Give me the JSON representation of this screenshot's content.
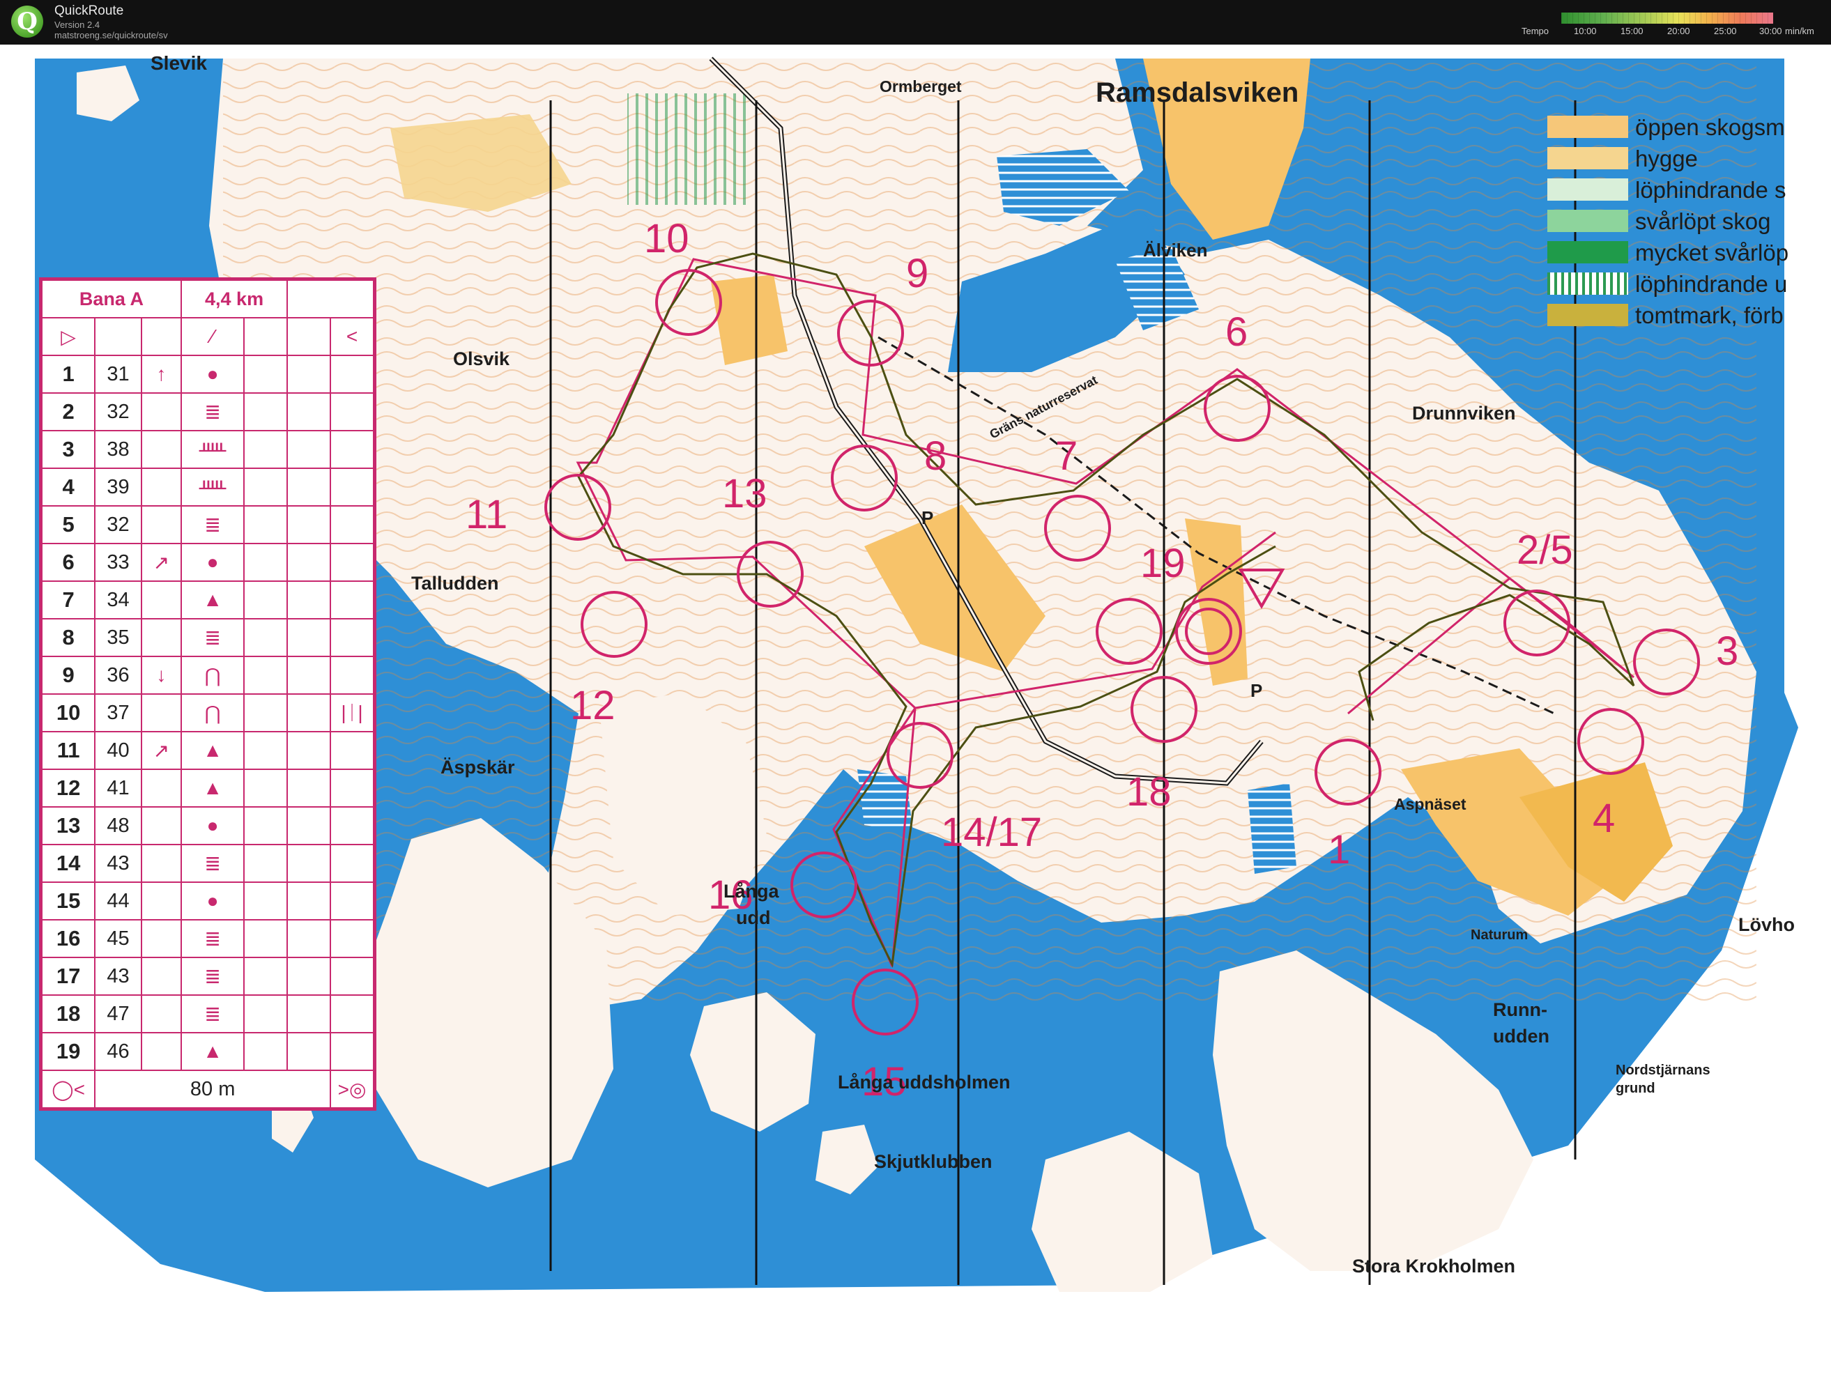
{
  "app": {
    "name": "QuickRoute",
    "version": "Version 2.4",
    "url": "matstroeng.se/quickroute/sv"
  },
  "tempo": {
    "label": "Tempo",
    "ticks": [
      "10:00",
      "15:00",
      "20:00",
      "25:00",
      "30:00"
    ],
    "unit": "min/km"
  },
  "map": {
    "places": {
      "slevik": "Slevik",
      "ormberget": "Ormberget",
      "ramsdalsviken": "Ramsdalsviken",
      "alviken": "Älviken",
      "olsvik": "Olsvik",
      "drunnviken": "Drunnviken",
      "talludden": "Talludden",
      "grans_naturreservat": "Gräns naturreservat",
      "aspskar": "Äspskär",
      "langa_udd_1": "Långa",
      "langa_udd_2": "udd",
      "aspnaset": "Aspnäset",
      "naturum": "Naturum",
      "lovho": "Lövho",
      "runnudden_1": "Runn-",
      "runnudden_2": "udden",
      "nordstjarnans_1": "Nordstjärnans",
      "nordstjarnans_2": "grund",
      "langa_uddsholmen": "Långa uddsholmen",
      "skjutklubben": "Skjutklubben",
      "stora_krokholmen": "Stora Krokholmen",
      "parking_1": "P",
      "parking_2": "P"
    },
    "control_labels": {
      "c1": "1",
      "c2_5": "2/5",
      "c3": "3",
      "c4": "4",
      "c6": "6",
      "c7": "7",
      "c8": "8",
      "c9": "9",
      "c10": "10",
      "c11": "11",
      "c12": "12",
      "c13": "13",
      "c14_17": "14/17",
      "c15": "15",
      "c16": "16",
      "c18": "18",
      "c19": "19"
    },
    "colors": {
      "water": "#2e8fd6",
      "land": "#fbf3ec",
      "open": "#f7c36a",
      "course": "#d1246a",
      "contour": "#e08a3c",
      "route": "#4c4f12"
    }
  },
  "legend": [
    {
      "label": "öppen skogsm",
      "color": "#f6c779"
    },
    {
      "label": "hygge",
      "color": "#f5d58f"
    },
    {
      "label": "löphindrande s",
      "color": "#d9efd9"
    },
    {
      "label": "svårlöpt skog",
      "color": "#8dd49c"
    },
    {
      "label": "mycket svårlöp",
      "color": "#1f9b4a"
    },
    {
      "label": "löphindrande u",
      "color": "#5aab6e"
    },
    {
      "label": "tomtmark, förb",
      "color": "#c9b13d"
    }
  ],
  "course": {
    "name": "Bana A",
    "length": "4,4 km",
    "controls": [
      {
        "num": "1",
        "code": "31",
        "dir": "↑",
        "feature": "●",
        "extra": ""
      },
      {
        "num": "2",
        "code": "32",
        "dir": "",
        "feature": "≣",
        "extra": ""
      },
      {
        "num": "3",
        "code": "38",
        "dir": "",
        "feature": "ᚊ",
        "extra": ""
      },
      {
        "num": "4",
        "code": "39",
        "dir": "",
        "feature": "ᚊ",
        "extra": ""
      },
      {
        "num": "5",
        "code": "32",
        "dir": "",
        "feature": "≣",
        "extra": ""
      },
      {
        "num": "6",
        "code": "33",
        "dir": "↗",
        "feature": "●",
        "extra": ""
      },
      {
        "num": "7",
        "code": "34",
        "dir": "",
        "feature": "▲",
        "extra": ""
      },
      {
        "num": "8",
        "code": "35",
        "dir": "",
        "feature": "≣",
        "extra": ""
      },
      {
        "num": "9",
        "code": "36",
        "dir": "↓",
        "feature": "⋂",
        "extra": ""
      },
      {
        "num": "10",
        "code": "37",
        "dir": "",
        "feature": "⋂",
        "extra": "|ᛁ|"
      },
      {
        "num": "11",
        "code": "40",
        "dir": "↗",
        "feature": "▲",
        "extra": ""
      },
      {
        "num": "12",
        "code": "41",
        "dir": "",
        "feature": "▲",
        "extra": ""
      },
      {
        "num": "13",
        "code": "48",
        "dir": "",
        "feature": "●",
        "extra": ""
      },
      {
        "num": "14",
        "code": "43",
        "dir": "",
        "feature": "≣",
        "extra": ""
      },
      {
        "num": "15",
        "code": "44",
        "dir": "",
        "feature": "●",
        "extra": ""
      },
      {
        "num": "16",
        "code": "45",
        "dir": "",
        "feature": "≣",
        "extra": ""
      },
      {
        "num": "17",
        "code": "43",
        "dir": "",
        "feature": "≣",
        "extra": ""
      },
      {
        "num": "18",
        "code": "47",
        "dir": "",
        "feature": "≣",
        "extra": ""
      },
      {
        "num": "19",
        "code": "46",
        "dir": "",
        "feature": "▲",
        "extra": ""
      }
    ],
    "finish_distance": "80 m"
  }
}
